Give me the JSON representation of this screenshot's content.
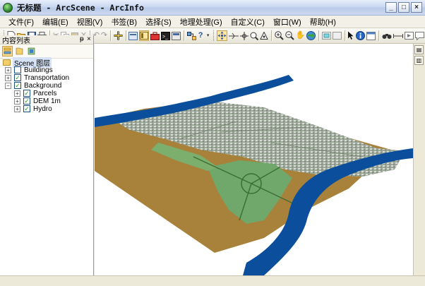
{
  "window": {
    "title": "无标题 - ArcScene - ArcInfo",
    "minimize": "_",
    "maximize": "□",
    "close": "×"
  },
  "menu": [
    "文件(F)",
    "编辑(E)",
    "视图(V)",
    "书签(B)",
    "选择(S)",
    "地理处理(G)",
    "自定义(C)",
    "窗口(W)",
    "帮助(H)"
  ],
  "toolbar": {
    "icons": [
      "new-document-icon",
      "open-icon",
      "save-icon",
      "print-icon",
      "cut-icon",
      "copy-icon",
      "paste-icon",
      "delete-icon",
      "undo-icon",
      "redo-icon",
      "add-data-icon",
      "layer-properties-icon",
      "catalog-icon",
      "arctoolbox-icon",
      "python-icon",
      "search-icon",
      "model-builder-icon",
      "whats-this-icon",
      "navigate-icon",
      "fly-icon",
      "center-target-icon",
      "zoom-to-target-icon",
      "set-observer-icon",
      "zoom-in-icon",
      "zoom-out-icon",
      "pan-icon",
      "full-extent-icon",
      "select-features-icon",
      "clear-selection-icon",
      "select-element-icon",
      "identify-icon",
      "html-popup-icon",
      "find-icon",
      "measure-icon",
      "animation-icon",
      "tooltip-icon"
    ]
  },
  "toc": {
    "title": "内容列表",
    "pin": "ᵽ",
    "close": "×",
    "scene_label": "Scene 图层",
    "layers": [
      {
        "name": "Buildings",
        "checked": false,
        "indent": 0
      },
      {
        "name": "Transportation",
        "checked": true,
        "indent": 0
      },
      {
        "name": "Background",
        "checked": true,
        "indent": 0,
        "expanded": true
      },
      {
        "name": "Parcels",
        "checked": true,
        "indent": 1
      },
      {
        "name": "DEM 1m",
        "checked": true,
        "indent": 1
      },
      {
        "name": "Hydro",
        "checked": true,
        "indent": 1
      }
    ]
  },
  "colors": {
    "terrain": "#a8813a",
    "water": "#0b4f9c",
    "park": "#6fa86a",
    "urban": "#9aa597"
  }
}
